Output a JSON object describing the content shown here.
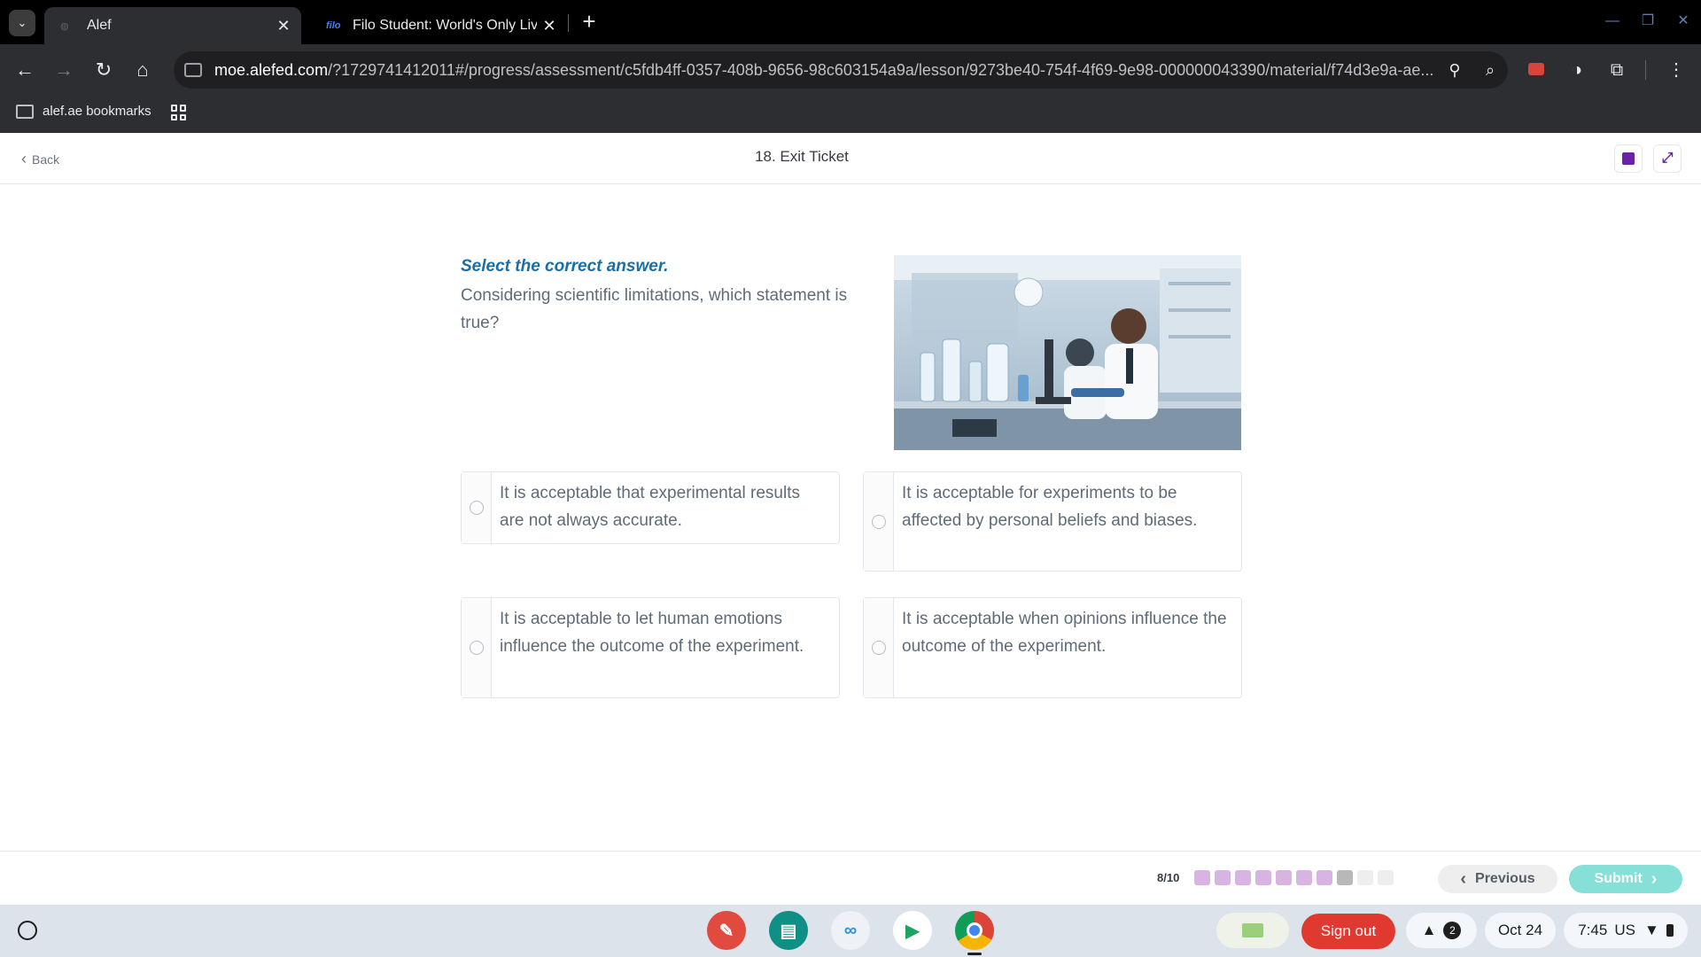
{
  "browser": {
    "tabs": [
      {
        "title": "Alef",
        "active": true
      },
      {
        "title": "Filo Student: World's Only Live I",
        "favicon_text": "filo",
        "active": false
      }
    ],
    "url_host": "moe.alefed.com",
    "url_path": "/?1729741412011#/progress/assessment/c5fdb4ff-0357-408b-9656-98c603154a9a/lesson/9273be40-754f-4f69-9e98-000000043390/material/f74d3e9a-ae...",
    "bookmark_folder": "alef.ae bookmarks"
  },
  "header": {
    "back_label": "Back",
    "title": "18. Exit Ticket"
  },
  "question": {
    "instruction": "Select the correct answer.",
    "text": "Considering scientific limitations, which statement is true?",
    "options": [
      {
        "text": "It is acceptable that experimental results are not always accurate."
      },
      {
        "text": "It is acceptable for experiments to be affected by personal beliefs and biases."
      },
      {
        "text": "It is acceptable to let human emotions influence the outcome of the experiment."
      },
      {
        "text": "It is acceptable when opinions influence the outcome of the experiment."
      }
    ]
  },
  "footer": {
    "progress_label": "8/10",
    "progress_current": 8,
    "progress_total": 10,
    "previous_label": "Previous",
    "submit_label": "Submit"
  },
  "shelf": {
    "signout_label": "Sign out",
    "notification_count": "2",
    "date": "Oct 24",
    "time": "7:45",
    "locale": "US"
  },
  "colors": {
    "accent_purple": "#d8b4e2",
    "current_step": "#b8b8b8",
    "pending_step": "#eeeeee",
    "instruction_blue": "#1a6fa8",
    "submit_teal": "#86e0d7",
    "signout_red": "#e0392f"
  }
}
